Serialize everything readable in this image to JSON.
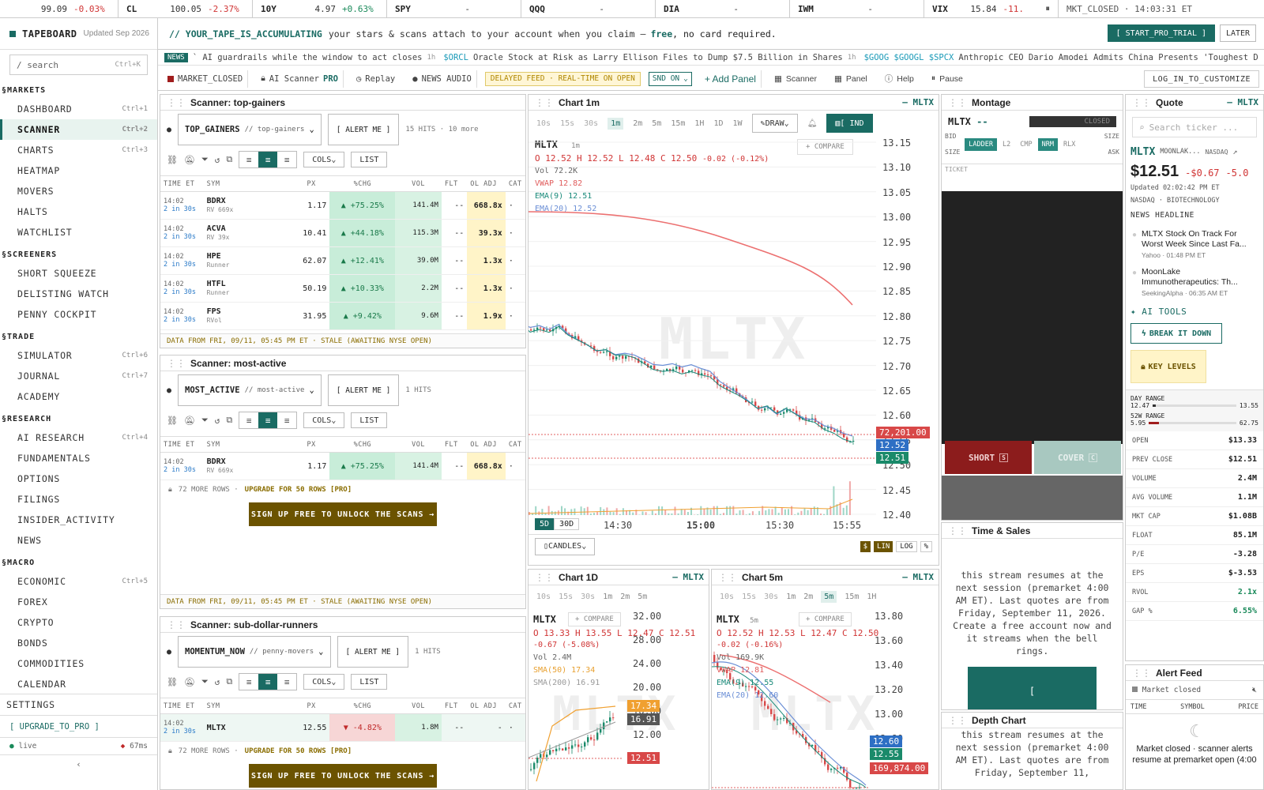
{
  "ticker": [
    {
      "sym": "",
      "px": "99.09",
      "chg": "-0.03%",
      "dir": "dn"
    },
    {
      "sym": "CL",
      "px": "100.05",
      "chg": "-2.37%",
      "dir": "dn"
    },
    {
      "sym": "10Y",
      "px": "4.97",
      "chg": "+0.63%",
      "dir": "up"
    },
    {
      "sym": "SPY",
      "px": "-",
      "chg": "",
      "dir": ""
    },
    {
      "sym": "QQQ",
      "px": "-",
      "chg": "",
      "dir": ""
    },
    {
      "sym": "DIA",
      "px": "-",
      "chg": "",
      "dir": ""
    },
    {
      "sym": "IWM",
      "px": "-",
      "chg": "",
      "dir": ""
    },
    {
      "sym": "VIX",
      "px": "15.84",
      "chg": "-11.",
      "dir": "dn"
    }
  ],
  "ticker_status": "MKT_CLOSED · 14:03:31 ET",
  "brand": {
    "name": "TAPEBOARD",
    "updated": "Updated Sep 2026"
  },
  "search": {
    "placeholder": "/ search",
    "shortcut": "Ctrl+K"
  },
  "sidebar": [
    {
      "section": "§MARKETS",
      "items": [
        {
          "label": "DASHBOARD",
          "key": "Ctrl+1"
        },
        {
          "label": "SCANNER",
          "key": "Ctrl+2",
          "active": true
        },
        {
          "label": "CHARTS",
          "key": "Ctrl+3"
        },
        {
          "label": "HEATMAP",
          "key": ""
        },
        {
          "label": "MOVERS",
          "key": ""
        },
        {
          "label": "HALTS",
          "key": ""
        },
        {
          "label": "WATCHLIST",
          "key": ""
        }
      ]
    },
    {
      "section": "§SCREENERS",
      "items": [
        {
          "label": "SHORT SQUEEZE",
          "key": ""
        },
        {
          "label": "DELISTING WATCH",
          "key": ""
        },
        {
          "label": "PENNY COCKPIT",
          "key": ""
        }
      ]
    },
    {
      "section": "§TRADE",
      "items": [
        {
          "label": "SIMULATOR",
          "key": "Ctrl+6"
        },
        {
          "label": "JOURNAL",
          "key": "Ctrl+7"
        },
        {
          "label": "ACADEMY",
          "key": ""
        }
      ]
    },
    {
      "section": "§RESEARCH",
      "items": [
        {
          "label": "AI RESEARCH",
          "key": "Ctrl+4"
        },
        {
          "label": "FUNDAMENTALS",
          "key": ""
        },
        {
          "label": "OPTIONS",
          "key": ""
        },
        {
          "label": "FILINGS",
          "key": ""
        },
        {
          "label": "INSIDER_ACTIVITY",
          "key": ""
        },
        {
          "label": "NEWS",
          "key": ""
        }
      ]
    },
    {
      "section": "§MACRO",
      "items": [
        {
          "label": "ECONOMIC",
          "key": "Ctrl+5"
        },
        {
          "label": "FOREX",
          "key": ""
        },
        {
          "label": "CRYPTO",
          "key": ""
        },
        {
          "label": "BONDS",
          "key": ""
        },
        {
          "label": "COMMODITIES",
          "key": ""
        },
        {
          "label": "CALENDAR",
          "key": ""
        }
      ]
    }
  ],
  "sidebar_bottom": {
    "settings": "SETTINGS",
    "upgrade": "[ UPGRADE_TO_PRO ]",
    "live": "live",
    "latency": "67ms"
  },
  "promo": {
    "headline": "// YOUR_TAPE_IS_ACCUMULATING",
    "text": "your stars & scans attach to your account when you claim —",
    "free": "free",
    "tail": ", no card required.",
    "cta": "[ START_PRO_TRIAL ]",
    "later": "LATER"
  },
  "news": [
    {
      "tags": "NEWS",
      "text": "` AI guardrails while the window to act closes",
      "time": "1h"
    },
    {
      "tags": "$ORCL",
      "text": "Oracle Stock at Risk as Larry Ellison Files to Dump $7.5 Billion in Shares",
      "time": "1h"
    },
    {
      "tags": "$GOOG $GOOGL $SPCX",
      "text": "Anthropic CEO Dario Amodei Admits China Presents 'Toughest D",
      "time": ""
    }
  ],
  "toolbar": {
    "market": "MARKET_CLOSED",
    "ai": "AI Scanner",
    "pro": "PRO",
    "replay": "Replay",
    "audio": "NEWS AUDIO",
    "delayed": "DELAYED FEED · REAL-TIME ON OPEN",
    "snd": "SND ON",
    "add": "+ Add Panel",
    "scanner": "Scanner",
    "panel": "Panel",
    "help": "Help",
    "pause": "Pause",
    "login": "LOG_IN_TO_CUSTOMIZE"
  },
  "scanners": [
    {
      "title": "Scanner: top-gainers",
      "preset": "TOP_GAINERS",
      "sub": "// top-gainers",
      "alert": "[ ALERT ME ]",
      "hits": "15 HITS · 10 more",
      "rows": [
        {
          "time": "14:02",
          "ago": "2 in 30s",
          "sym": "BDRX",
          "sub": "RV 669x",
          "px": "1.17",
          "pct": "▲ +75.25%",
          "vol": "141.4M",
          "flt": "--",
          "adj": "668.8x"
        },
        {
          "time": "14:02",
          "ago": "2 in 30s",
          "sym": "ACVA",
          "sub": "RV 39x",
          "px": "10.41",
          "pct": "▲ +44.18%",
          "vol": "115.3M",
          "flt": "--",
          "adj": "39.3x"
        },
        {
          "time": "14:02",
          "ago": "2 in 30s",
          "sym": "HPE",
          "sub": "Runner",
          "px": "62.07",
          "pct": "▲ +12.41%",
          "vol": "39.0M",
          "flt": "--",
          "adj": "1.3x"
        },
        {
          "time": "14:02",
          "ago": "2 in 30s",
          "sym": "HTFL",
          "sub": "Runner",
          "px": "50.19",
          "pct": "▲ +10.33%",
          "vol": "2.2M",
          "flt": "--",
          "adj": "1.3x"
        },
        {
          "time": "14:02",
          "ago": "2 in 30s",
          "sym": "FPS",
          "sub": "RVol",
          "px": "31.95",
          "pct": "▲ +9.42%",
          "vol": "9.6M",
          "flt": "--",
          "adj": "1.9x"
        }
      ],
      "foot": "DATA FROM FRI, 09/11, 05:45 PM ET · STALE (AWAITING NYSE OPEN)"
    },
    {
      "title": "Scanner: most-active",
      "preset": "MOST_ACTIVE",
      "sub": "// most-active",
      "alert": "[ ALERT ME ]",
      "hits": "1 HITS",
      "rows": [
        {
          "time": "14:02",
          "ago": "2 in 30s",
          "sym": "BDRX",
          "sub": "RV 669x",
          "px": "1.17",
          "pct": "▲ +75.25%",
          "vol": "141.4M",
          "flt": "--",
          "adj": "668.8x"
        }
      ],
      "more": "72 MORE ROWS ·",
      "upgrade": "UPGRADE FOR 50 ROWS [PRO]",
      "signup": "SIGN UP FREE TO UNLOCK THE SCANS →",
      "foot": "DATA FROM FRI, 09/11, 05:45 PM ET · STALE (AWAITING NYSE OPEN)"
    },
    {
      "title": "Scanner: sub-dollar-runners",
      "preset": "MOMENTUM_NOW",
      "sub": "// penny-movers",
      "alert": "[ ALERT ME ]",
      "hits": "1 HITS",
      "rows": [
        {
          "time": "14:02",
          "ago": "2 in 30s",
          "sym": "MLTX",
          "sub": "",
          "px": "12.55",
          "pct": "▼ -4.82%",
          "vol": "1.8M",
          "flt": "--",
          "adj": "-"
        }
      ],
      "more": "72 MORE ROWS ·",
      "upgrade": "UPGRADE FOR 50 ROWS [PRO]",
      "signup": "SIGN UP FREE TO UNLOCK THE SCANS →"
    }
  ],
  "cols": {
    "time": "TIME ET",
    "sym": "SYM",
    "px": "PX",
    "chg": "%CHG",
    "vol": "VOL",
    "flt": "FLT",
    "adj": "OL ADJ",
    "cat": "CAT",
    "colsbtn": "COLS",
    "list": "LIST"
  },
  "chart1m": {
    "title": "Chart 1m",
    "sym": "— MLTX",
    "intervals": [
      "10s",
      "15s",
      "30s",
      "1m",
      "2m",
      "5m",
      "15m",
      "1H",
      "1D",
      "1W"
    ],
    "active": "1m",
    "draw": "DRAW",
    "ind": "[ IND",
    "ticker": "MLTX",
    "tf": "1m",
    "ohlc": "O 12.52 H 12.52 L 12.48 C 12.50",
    "chg": "-0.02 (-0.12%)",
    "vol": "Vol 72.2K",
    "vwap": "VWAP 12.82",
    "ema9": "EMA(9) 12.51",
    "ema20": "EMA(20) 12.52",
    "compare": "+ COMPARE",
    "yticks": [
      "13.15",
      "13.10",
      "13.05",
      "13.00",
      "12.95",
      "12.90",
      "12.85",
      "12.80",
      "12.75",
      "12.70",
      "12.65",
      "12.60",
      "12.55",
      "12.50",
      "12.45",
      "12.40"
    ],
    "xticks": [
      "14:30",
      "15:00",
      "15:30",
      "15:55"
    ],
    "tags": [
      "72,201.00",
      "12.52",
      "12.51"
    ],
    "ranges": [
      "5D",
      "30D"
    ],
    "candles": "CANDLES",
    "lin": "LIN",
    "log": "LOG",
    "pct": "%",
    "usd": "$",
    "watermark": "MLTX"
  },
  "montage": {
    "title": "Montage",
    "sym": "MLTX",
    "dash": "--",
    "closed": "CLOSED",
    "bid": "BID",
    "size": "SIZE",
    "ask": "ASK",
    "tabs": [
      "LADDER",
      "L2",
      "CMP",
      "NRM",
      "RLX"
    ],
    "ticket": "TICKET",
    "short": "SHORT",
    "cover": "COVER",
    "short_key": "S",
    "cover_key": "C"
  },
  "quote": {
    "title": "Quote",
    "sym": "— MLTX",
    "search": "Search ticker ...",
    "ticker": "MLTX",
    "name": "MOONLAK...",
    "exch": "NASDAQ",
    "price": "$12.51",
    "chg": "-$0.67",
    "chgp": "-5.0",
    "updated": "Updated 02:02:42 PM ET",
    "tags": "NASDAQ · BIOTECHNOLOGY",
    "newshead": "NEWS HEADLINE",
    "news": [
      {
        "title": "MLTX Stock On Track For Worst Week Since Last Fa...",
        "src": "Yahoo · 01:48 PM ET"
      },
      {
        "title": "MoonLake Immunotherapeutics: Th...",
        "src": "SeekingAlpha · 06:35 AM ET"
      }
    ],
    "aitools": "AI TOOLS",
    "break": "BREAK IT DOWN",
    "levels": "KEY LEVELS",
    "dayrange": {
      "label": "DAY RANGE",
      "lo": "12.47",
      "hi": "13.55"
    },
    "w52": {
      "label": "52W RANGE",
      "lo": "5.95",
      "hi": "62.75"
    },
    "stats": [
      {
        "k": "OPEN",
        "v": "$13.33"
      },
      {
        "k": "PREV CLOSE",
        "v": "$12.51"
      },
      {
        "k": "VOLUME",
        "v": "2.4M"
      },
      {
        "k": "AVG VOLUME",
        "v": "1.1M"
      },
      {
        "k": "MKT CAP",
        "v": "$1.08B"
      },
      {
        "k": "FLOAT",
        "v": "85.1M"
      },
      {
        "k": "P/E",
        "v": "-3.28"
      },
      {
        "k": "EPS",
        "v": "$-3.53"
      },
      {
        "k": "RVOL",
        "v": "2.1x"
      },
      {
        "k": "GAP %",
        "v": "6.55%"
      }
    ]
  },
  "timesales": {
    "title": "Time & Sales",
    "text": "this stream resumes at the next session (premarket 4:00 AM ET). Last quotes are from Friday, September 11, 2026. Create a free account now and it streams when the bell rings.",
    "btn": "["
  },
  "depth": {
    "title": "Depth Chart",
    "text": "this stream resumes at the next session (premarket 4:00 AM ET). Last quotes are from Friday, September 11,"
  },
  "alertfeed": {
    "title": "Alert Feed",
    "status": "Market closed",
    "cols": [
      "TIME",
      "SYMBOL",
      "PRICE"
    ],
    "msg": "Market closed · scanner alerts resume at premarket open (4:00"
  },
  "chart1d": {
    "title": "Chart 1D",
    "sym": "— MLTX",
    "intervals": [
      "10s",
      "15s",
      "30s",
      "1m",
      "2m",
      "5m"
    ],
    "ticker": "MLTX",
    "ohlc": "O 13.33 H 13.55 L 12.47 C 12.51",
    "chg": "-0.67 (-5.08%)",
    "vol": "Vol 2.4M",
    "sma50": "SMA(50) 17.34",
    "sma200": "SMA(200) 16.91",
    "yticks": [
      "32.00",
      "28.00",
      "24.00",
      "20.00",
      "16.00",
      "12.00",
      "8.00"
    ],
    "tags": [
      "17.34",
      "16.91",
      "12.51"
    ],
    "compare": "+ COMPARE",
    "watermark": "MLTX"
  },
  "chart5m": {
    "title": "Chart 5m",
    "sym": "— MLTX",
    "intervals": [
      "10s",
      "15s",
      "30s",
      "1m",
      "2m",
      "5m",
      "15m",
      "1H"
    ],
    "active": "5m",
    "ticker": "MLTX",
    "tf": "5m",
    "ohlc": "O 12.52 H 12.53 L 12.47 C 12.50",
    "chg": "-0.02 (-0.16%)",
    "vol": "Vol 169.9K",
    "vwap": "VWAP 12.81",
    "ema9": "EMA(9) 12.55",
    "ema20": "EMA(20) 12.60",
    "yticks": [
      "13.80",
      "13.60",
      "13.40",
      "13.20",
      "13.00",
      "12.80"
    ],
    "tags": [
      "12.60",
      "12.55",
      "169,874.00"
    ],
    "compare": "+ COMPARE",
    "watermark": "MLTX"
  }
}
